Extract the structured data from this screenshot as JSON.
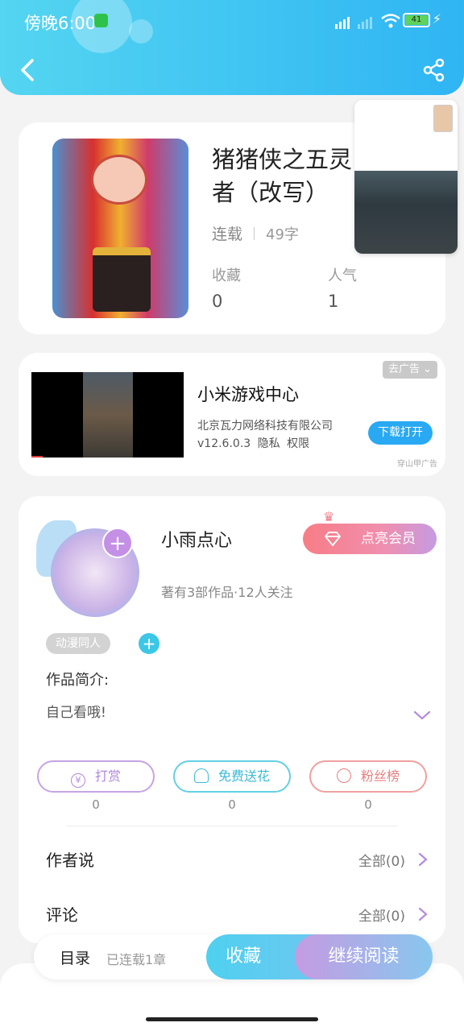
{
  "status_bar": {
    "time": "傍晚6:00",
    "battery": "41"
  },
  "book": {
    "title": "猪猪侠之五灵者（改写）",
    "status": "连载",
    "word_count": "49字",
    "stats": [
      {
        "label": "收藏",
        "value": "0"
      },
      {
        "label": "人气",
        "value": "1"
      }
    ]
  },
  "ad": {
    "close_label": "去广告",
    "title": "小米游戏中心",
    "company": "北京瓦力网络科技有限公司",
    "version_line": "v12.6.0.3 隐私 权限",
    "download_label": "下载打开",
    "source": "穿山甲广告"
  },
  "author": {
    "name": "小雨点心",
    "vip_label": "点亮会员",
    "subtitle": "著有3部作品·12人关注",
    "tag": "动漫同人",
    "intro_label": "作品简介:",
    "intro_text": "自己看哦!"
  },
  "actions": [
    {
      "label": "打赏",
      "count": "0"
    },
    {
      "label": "免费送花",
      "count": "0"
    },
    {
      "label": "粉丝榜",
      "count": "0"
    }
  ],
  "sections": [
    {
      "title": "作者说",
      "more": "全部(0)"
    },
    {
      "title": "评论",
      "more": "全部(0)"
    }
  ],
  "bottom_bar": {
    "menu_label": "目录",
    "progress_status": "已连载1章",
    "favorite_label": "收藏",
    "continue_label": "继续阅读"
  }
}
